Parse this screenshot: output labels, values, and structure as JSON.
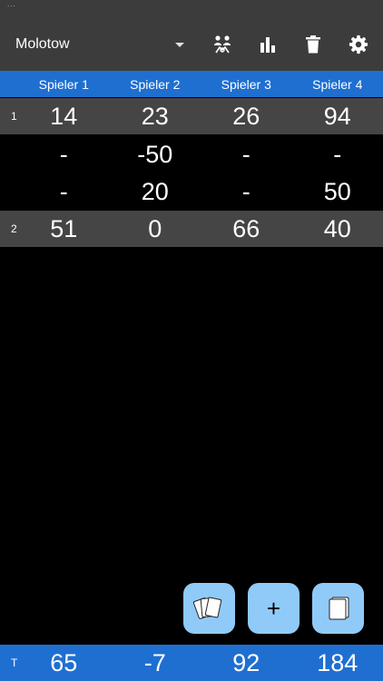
{
  "status": {
    "dots": "..."
  },
  "toolbar": {
    "game_name": "Molotow",
    "icons": [
      "players-icon",
      "bar-chart-icon",
      "trash-icon",
      "gear-icon"
    ]
  },
  "players": [
    "Spieler 1",
    "Spieler 2",
    "Spieler 3",
    "Spieler 4"
  ],
  "rows": [
    {
      "index": "1",
      "type": "sum",
      "values": [
        "14",
        "23",
        "26",
        "94"
      ]
    },
    {
      "index": "",
      "type": "detail",
      "values": [
        "-",
        "-50",
        "-",
        "-"
      ]
    },
    {
      "index": "",
      "type": "detail",
      "values": [
        "-",
        "20",
        "-",
        "50"
      ]
    },
    {
      "index": "2",
      "type": "sum",
      "values": [
        "51",
        "0",
        "66",
        "40"
      ]
    }
  ],
  "fab": {
    "plus_label": "+"
  },
  "totals": {
    "label": "T",
    "values": [
      "65",
      "-7",
      "92",
      "184"
    ]
  },
  "colors": {
    "appbar": "#3c3c3c",
    "accent": "#1f6fd1",
    "sum_row": "#454545",
    "fab": "#90caf9"
  }
}
